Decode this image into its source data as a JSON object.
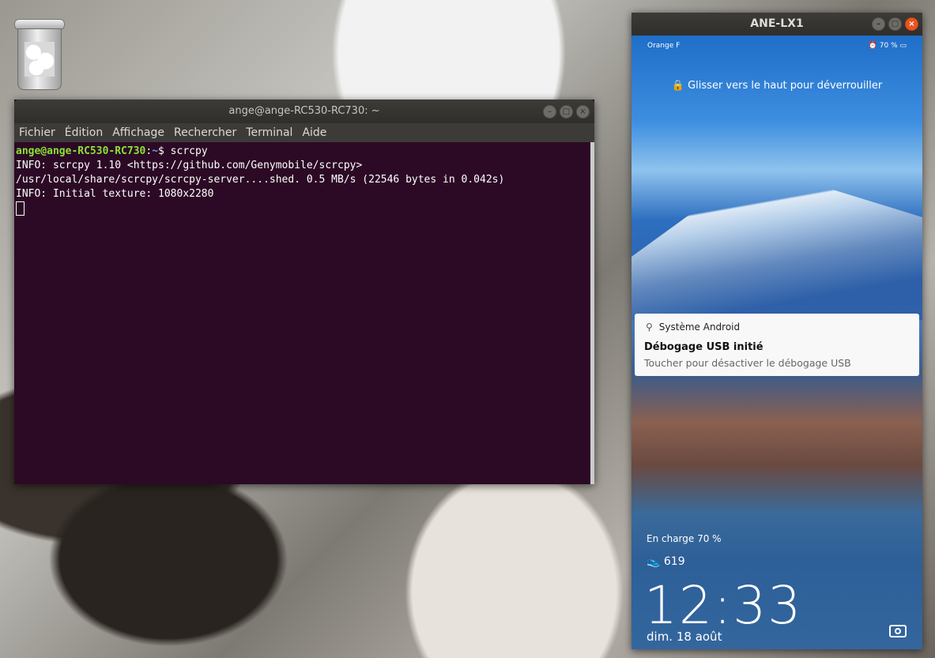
{
  "desktop": {
    "trash_icon": "trash-icon"
  },
  "terminal": {
    "title": "ange@ange-RC530-RC730: ~",
    "window_buttons": [
      "–",
      "□",
      "×"
    ],
    "menu": [
      "Fichier",
      "Édition",
      "Affichage",
      "Rechercher",
      "Terminal",
      "Aide"
    ],
    "lines": {
      "user": "ange@ange-RC530-RC730",
      "sep": ":",
      "path": "~",
      "cmd": "$ scrcpy",
      "l1": "INFO: scrcpy 1.10 <https://github.com/Genymobile/scrcpy>",
      "l2": "/usr/local/share/scrcpy/scrcpy-server....shed. 0.5 MB/s (22546 bytes in 0.042s)",
      "l3": "INFO: Initial texture: 1080x2280"
    }
  },
  "phone": {
    "title": "ANE-LX1",
    "window_buttons": [
      "–",
      "□",
      "×"
    ],
    "status": {
      "carrier": "Orange F",
      "battery": "70 %"
    },
    "unlock_hint": "Glisser vers le haut pour déverrouiller",
    "notification": {
      "app": "Système Android",
      "title": "Débogage USB initié",
      "text": "Toucher pour désactiver le débogage USB"
    },
    "charging": "En charge 70 %",
    "steps": "619",
    "time": "12:33",
    "date": "dim. 18 août"
  }
}
